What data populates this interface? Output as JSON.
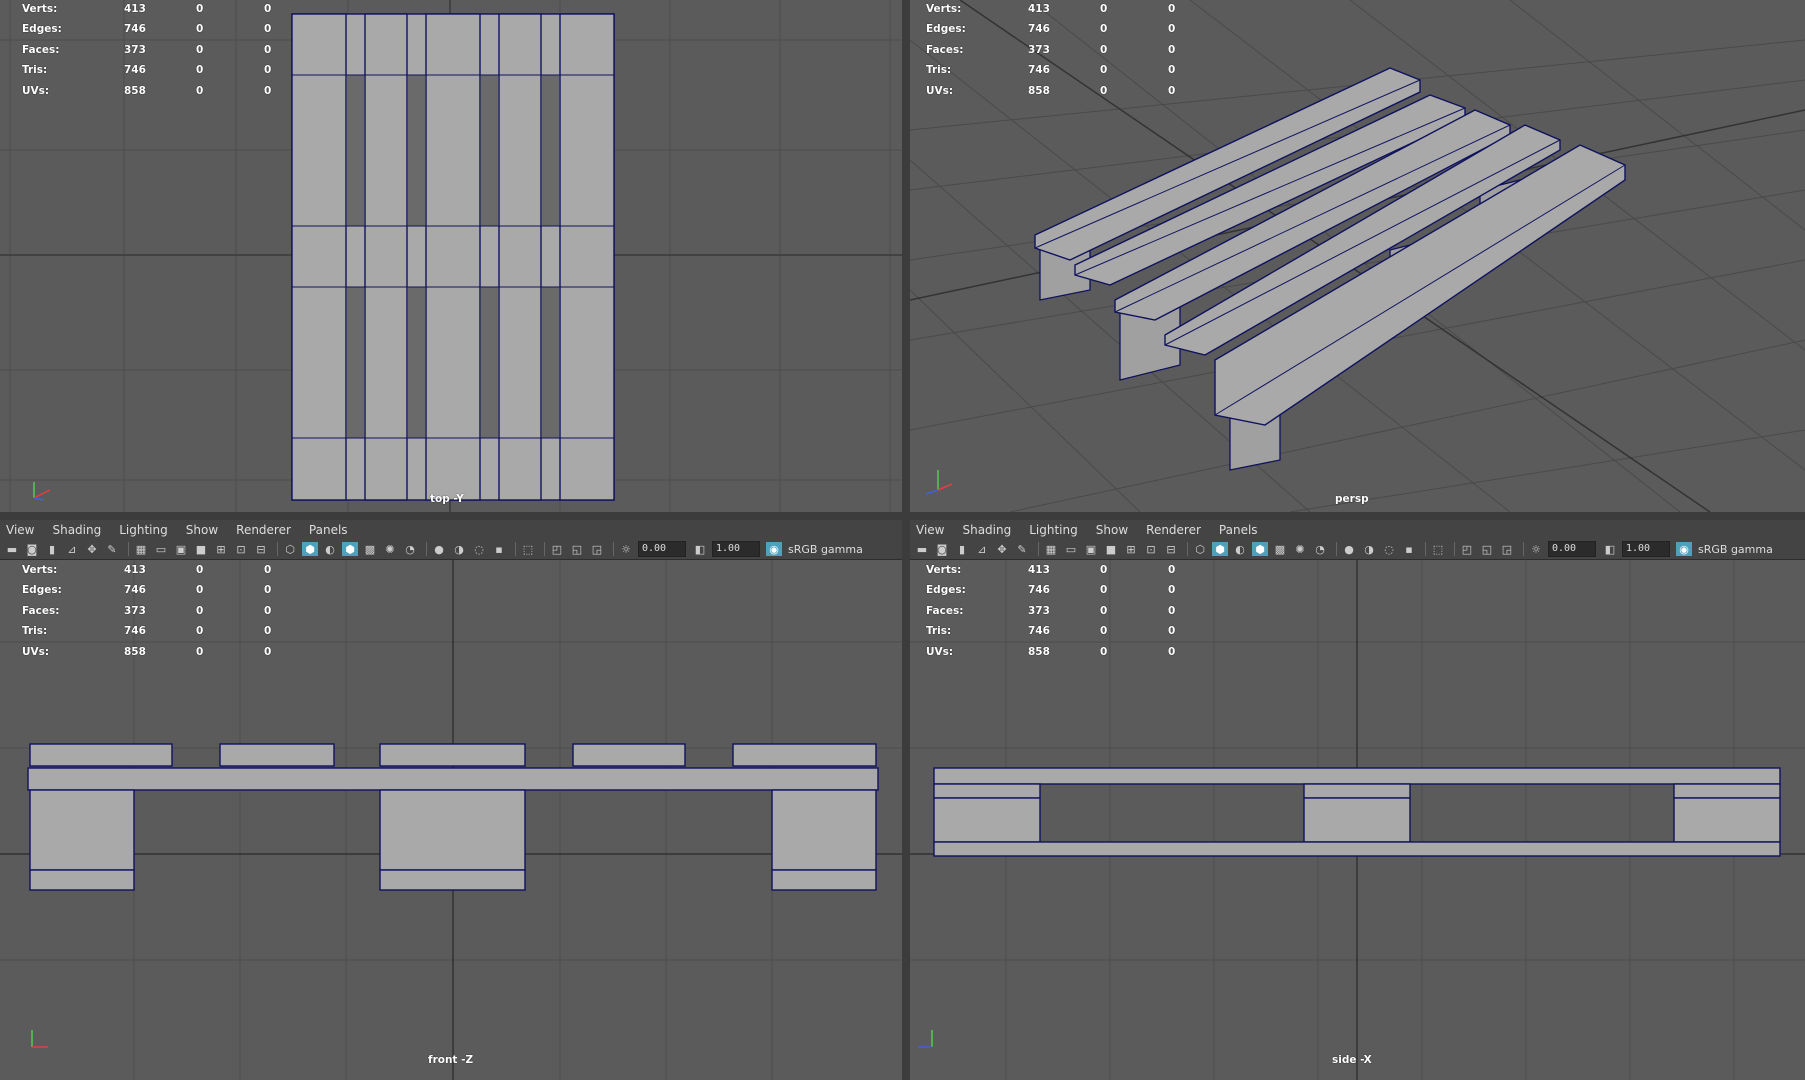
{
  "hud": {
    "rows": [
      {
        "label": "Verts:",
        "value": "413",
        "sel": "0",
        "tri": "0"
      },
      {
        "label": "Edges:",
        "value": "746",
        "sel": "0",
        "tri": "0"
      },
      {
        "label": "Faces:",
        "value": "373",
        "sel": "0",
        "tri": "0"
      },
      {
        "label": "Tris:",
        "value": "746",
        "sel": "0",
        "tri": "0"
      },
      {
        "label": "UVs:",
        "value": "858",
        "sel": "0",
        "tri": "0"
      }
    ]
  },
  "menus": [
    "View",
    "Shading",
    "Lighting",
    "Show",
    "Renderer",
    "Panels"
  ],
  "toolbar": {
    "exposure": "0.00",
    "gamma": "1.00",
    "colorspace": "sRGB gamma"
  },
  "viewports": {
    "top": {
      "camera": "top -Y"
    },
    "persp": {
      "camera": "persp"
    },
    "front": {
      "camera": "front -Z"
    },
    "side": {
      "camera": "side -X"
    }
  },
  "colors": {
    "viewport_bg": "#5b5b5b",
    "grid": "#4a4a4a",
    "axis": "#2b2b2b",
    "mesh_fill": "#a9a9a9",
    "wire": "#10125e",
    "highlight": "#4fa1bb"
  }
}
